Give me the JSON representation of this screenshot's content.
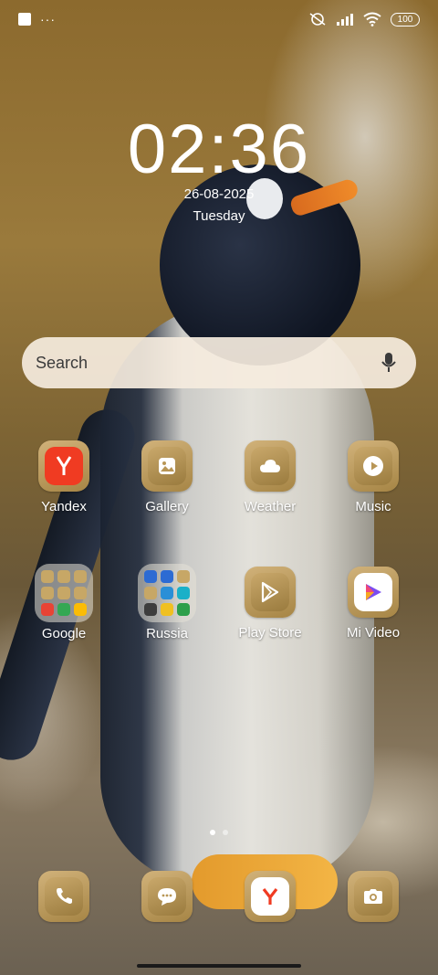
{
  "status_bar": {
    "dots": "···",
    "battery": "100"
  },
  "clock": {
    "time": "02:36",
    "date": "26-08-2025",
    "day": "Tuesday"
  },
  "search": {
    "placeholder": "Search"
  },
  "apps": {
    "row1": [
      {
        "label": "Yandex",
        "icon": "yandex-icon"
      },
      {
        "label": "Gallery",
        "icon": "gallery-icon"
      },
      {
        "label": "Weather",
        "icon": "cloud-icon"
      },
      {
        "label": "Music",
        "icon": "play-icon"
      }
    ],
    "row2": [
      {
        "label": "Google",
        "icon": "folder-icon"
      },
      {
        "label": "Russia",
        "icon": "folder-icon"
      },
      {
        "label": "Play Store",
        "icon": "play-store-icon"
      },
      {
        "label": "Mi Video",
        "icon": "mi-video-icon"
      }
    ]
  },
  "dock": [
    {
      "icon": "phone-icon"
    },
    {
      "icon": "messages-icon"
    },
    {
      "icon": "yandex-browser-icon"
    },
    {
      "icon": "camera-icon"
    }
  ],
  "colors": {
    "icon_gold": "#b89656",
    "yandex_red": "#f03b22",
    "search_bg": "#f5ebde"
  }
}
